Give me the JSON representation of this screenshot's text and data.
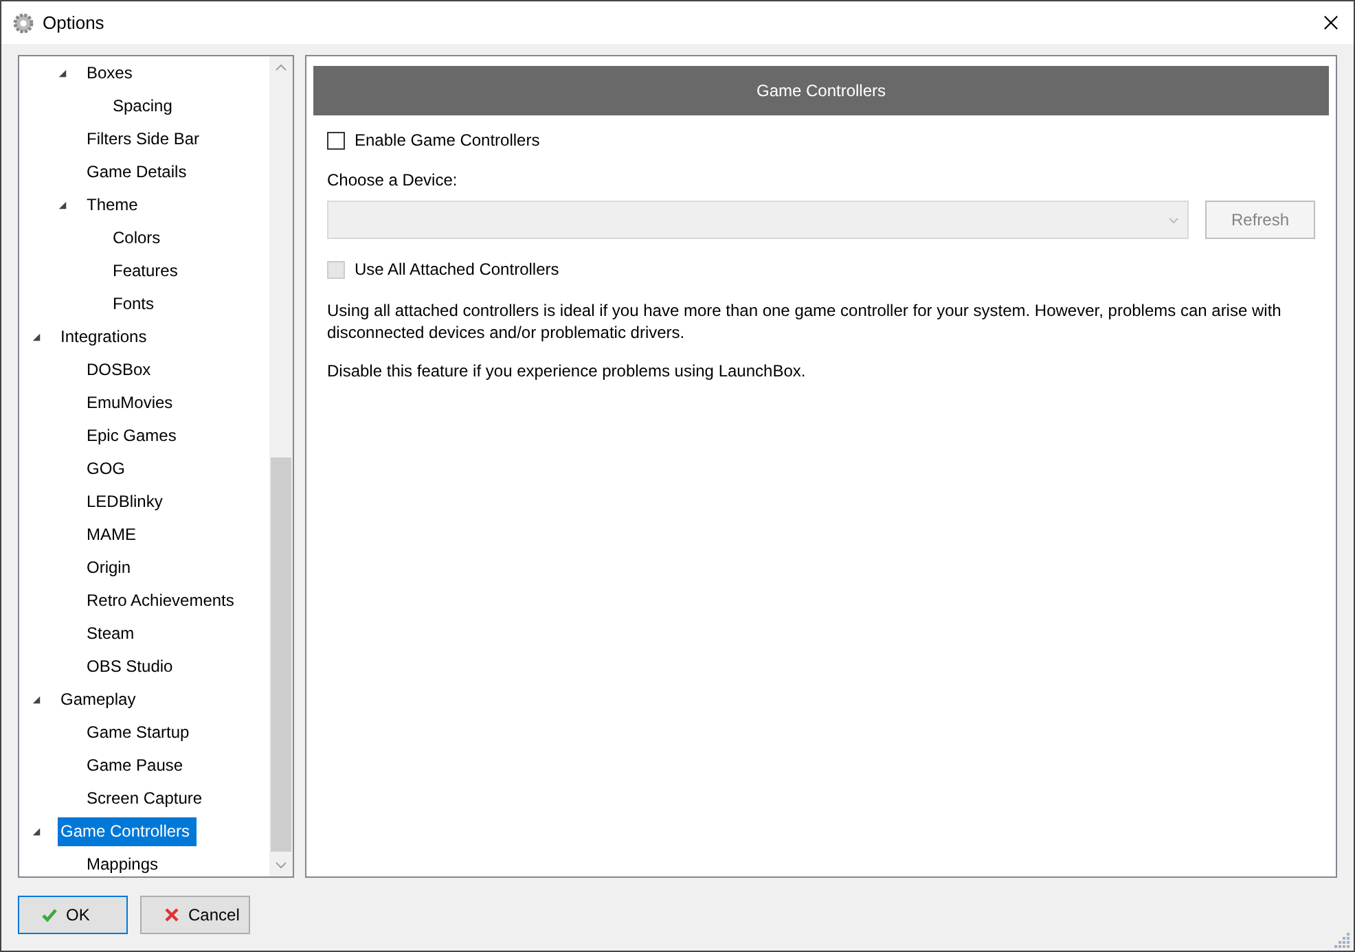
{
  "window": {
    "title": "Options"
  },
  "tree": {
    "items": [
      {
        "children": [
          {
            "label": "Boxes",
            "expanded": true,
            "selected": false,
            "children": [
              {
                "label": "Spacing",
                "selected": false
              }
            ]
          },
          {
            "label": "Filters Side Bar",
            "selected": false
          },
          {
            "label": "Game Details",
            "selected": false
          },
          {
            "label": "Theme",
            "expanded": true,
            "selected": false,
            "children": [
              {
                "label": "Colors",
                "selected": false
              },
              {
                "label": "Features",
                "selected": false
              },
              {
                "label": "Fonts",
                "selected": false
              }
            ]
          }
        ]
      },
      {
        "label": "Integrations",
        "expanded": true,
        "selected": false,
        "children": [
          {
            "label": "DOSBox",
            "selected": false
          },
          {
            "label": "EmuMovies",
            "selected": false
          },
          {
            "label": "Epic Games",
            "selected": false
          },
          {
            "label": "GOG",
            "selected": false
          },
          {
            "label": "LEDBlinky",
            "selected": false
          },
          {
            "label": "MAME",
            "selected": false
          },
          {
            "label": "Origin",
            "selected": false
          },
          {
            "label": "Retro Achievements",
            "selected": false
          },
          {
            "label": "Steam",
            "selected": false
          },
          {
            "label": "OBS Studio",
            "selected": false
          }
        ]
      },
      {
        "label": "Gameplay",
        "expanded": true,
        "selected": false,
        "children": [
          {
            "label": "Game Startup",
            "selected": false
          },
          {
            "label": "Game Pause",
            "selected": false
          },
          {
            "label": "Screen Capture",
            "selected": false
          }
        ]
      },
      {
        "label": "Game Controllers",
        "expanded": true,
        "selected": true,
        "children": [
          {
            "label": "Mappings",
            "selected": false
          }
        ]
      }
    ]
  },
  "panel": {
    "title": "Game Controllers",
    "enable_checkbox": {
      "label": "Enable Game Controllers",
      "checked": false,
      "disabled": false
    },
    "device_label": "Choose a Device:",
    "device_dropdown": {
      "disabled": true
    },
    "refresh_button": {
      "label": "Refresh",
      "disabled": true
    },
    "use_all_checkbox": {
      "label": "Use All Attached Controllers",
      "checked": false,
      "disabled": true
    },
    "paragraphs": [
      "Using all attached controllers is ideal if you have more than one game controller for your system. However, problems can arise with disconnected devices and/or problematic drivers.",
      "Disable this feature if you experience problems using LaunchBox."
    ]
  },
  "buttons": [
    {
      "label": "OK",
      "kind": "ok",
      "focused": true
    },
    {
      "label": "Cancel",
      "kind": "cancel",
      "focused": false
    }
  ]
}
